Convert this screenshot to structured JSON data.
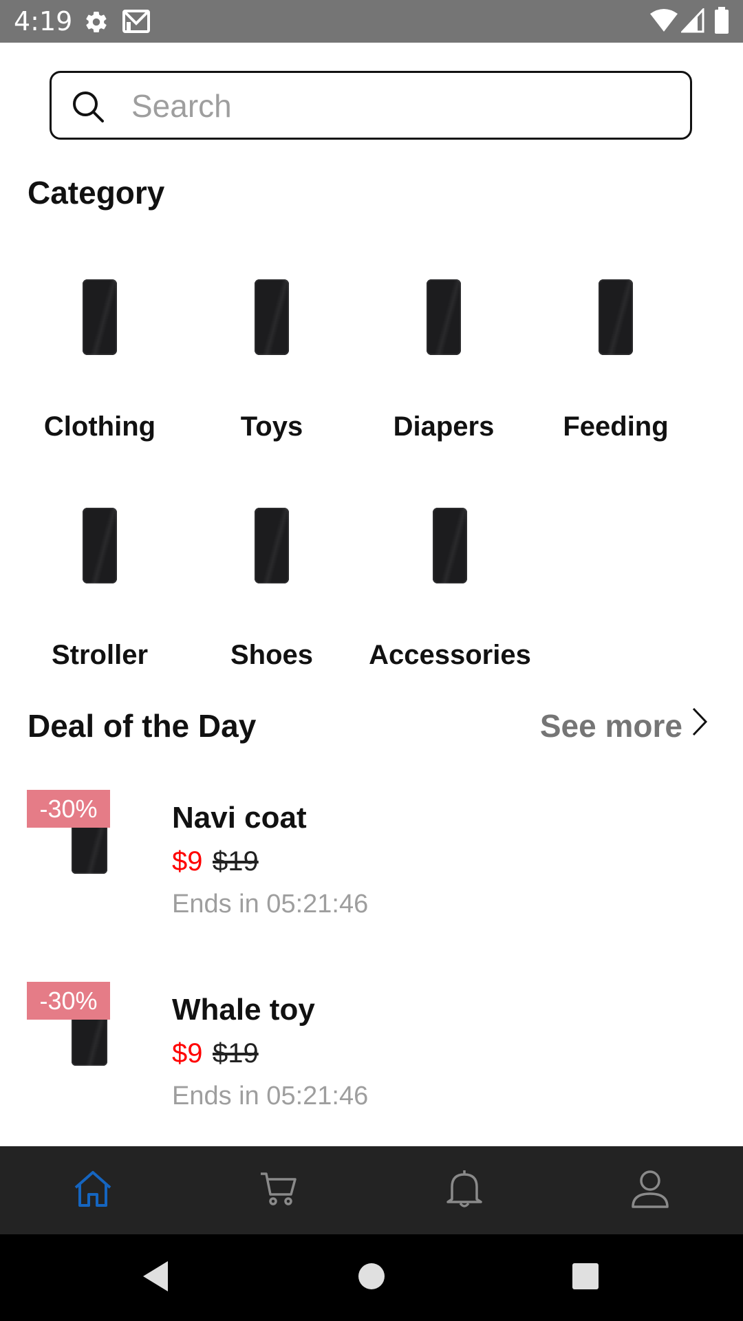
{
  "status_bar": {
    "time": "4:19",
    "icons": [
      "gear-icon",
      "gmail-icon",
      "wifi-icon",
      "signal-icon",
      "battery-icon"
    ]
  },
  "search": {
    "placeholder": "Search",
    "value": ""
  },
  "category": {
    "title": "Category",
    "items": [
      {
        "label": "Clothing",
        "icon": "phone-image"
      },
      {
        "label": "Toys",
        "icon": "phone-image"
      },
      {
        "label": "Diapers",
        "icon": "phone-image"
      },
      {
        "label": "Feeding",
        "icon": "phone-image"
      },
      {
        "label": "Stroller",
        "icon": "phone-image"
      },
      {
        "label": "Shoes",
        "icon": "phone-image"
      },
      {
        "label": "Accessories",
        "icon": "phone-image"
      }
    ]
  },
  "deals": {
    "title": "Deal of the Day",
    "see_more": "See more",
    "items": [
      {
        "badge": "-30%",
        "name": "Navi coat",
        "price": "$9",
        "old_price": "$19",
        "ends": "Ends in 05:21:46"
      },
      {
        "badge": "-30%",
        "name": "Whale toy",
        "price": "$9",
        "old_price": "$19",
        "ends": "Ends in 05:21:46"
      }
    ]
  },
  "bottom_nav": {
    "items": [
      {
        "icon": "home-icon",
        "active": true
      },
      {
        "icon": "cart-icon",
        "active": false
      },
      {
        "icon": "bell-icon",
        "active": false
      },
      {
        "icon": "profile-icon",
        "active": false
      }
    ],
    "active_color": "#1565c0",
    "inactive_color": "#8a8a8a"
  },
  "colors": {
    "discount_badge": "#e57c87",
    "price": "#ff0000",
    "muted": "#9e9e9e"
  }
}
